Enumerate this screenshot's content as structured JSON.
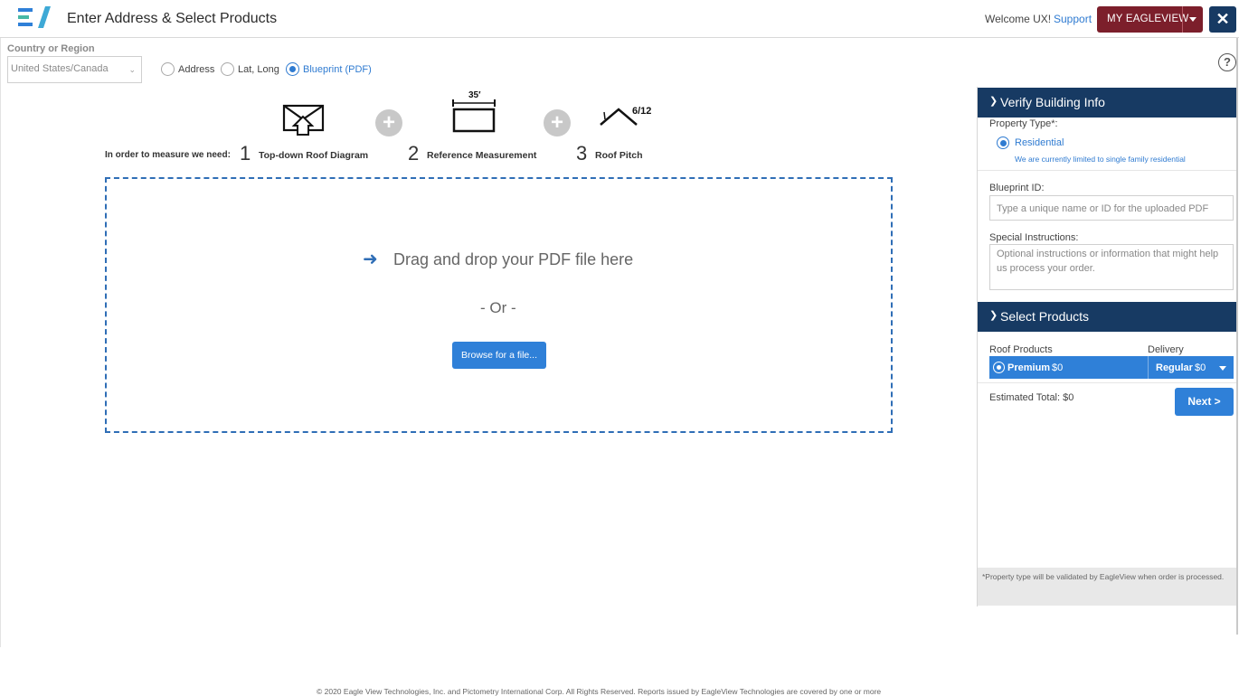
{
  "header": {
    "title": "Enter Address & Select Products",
    "welcome": "Welcome UX!",
    "support": "Support",
    "my_eagleview": "MY EAGLEVIEW",
    "close_symbol": "✕",
    "brand_colors": {
      "maroon": "#7c1f2b",
      "navy": "#173a63",
      "blue": "#2f80d8"
    }
  },
  "location": {
    "country_label": "Country or Region",
    "country_value": "United States/Canada",
    "modes": [
      {
        "label": "Address",
        "selected": false
      },
      {
        "label": "Lat, Long",
        "selected": false
      },
      {
        "label": "Blueprint (PDF)",
        "selected": true
      }
    ],
    "help_symbol": "?"
  },
  "requirements": {
    "intro": "In order to measure we need:",
    "steps": [
      {
        "number": "1",
        "label": "Top-down Roof Diagram",
        "icon": "roof-diagram-icon"
      },
      {
        "number": "2",
        "label": "Reference Measurement",
        "icon": "measurement-icon",
        "icon_text": "35′"
      },
      {
        "number": "3",
        "label": "Roof Pitch",
        "icon": "roof-pitch-icon",
        "icon_text": "6/12"
      }
    ],
    "plus_symbol": "+"
  },
  "upload": {
    "arrow": "➜",
    "drag_text": "Drag and drop your PDF file here",
    "or_text": "- Or -",
    "browse_label": "Browse for a file..."
  },
  "verify": {
    "heading": "Verify Building Info",
    "property_type_label": "Property Type*:",
    "property_type_value": "Residential",
    "property_note": "We are currently limited to single family residential",
    "blueprint_label": "Blueprint ID:",
    "blueprint_placeholder": "Type a unique name or ID for the uploaded PDF",
    "instructions_label": "Special Instructions:",
    "instructions_placeholder": "Optional instructions or information that might help us process your order."
  },
  "products": {
    "heading": "Select Products",
    "col_products": "Roof Products",
    "col_delivery": "Delivery",
    "selected_product": "Premium",
    "product_price": "$0",
    "delivery": "Regular",
    "delivery_price": "$0",
    "estimated_total": "Estimated Total: $0",
    "next_label": "Next >",
    "footnote": "*Property type will be validated by EagleView when order is processed."
  },
  "footer": {
    "copyright": "© 2020 Eagle View Technologies, Inc. and Pictometry International Corp. All Rights Reserved. Reports issued by EagleView Technologies are covered by one or more"
  }
}
